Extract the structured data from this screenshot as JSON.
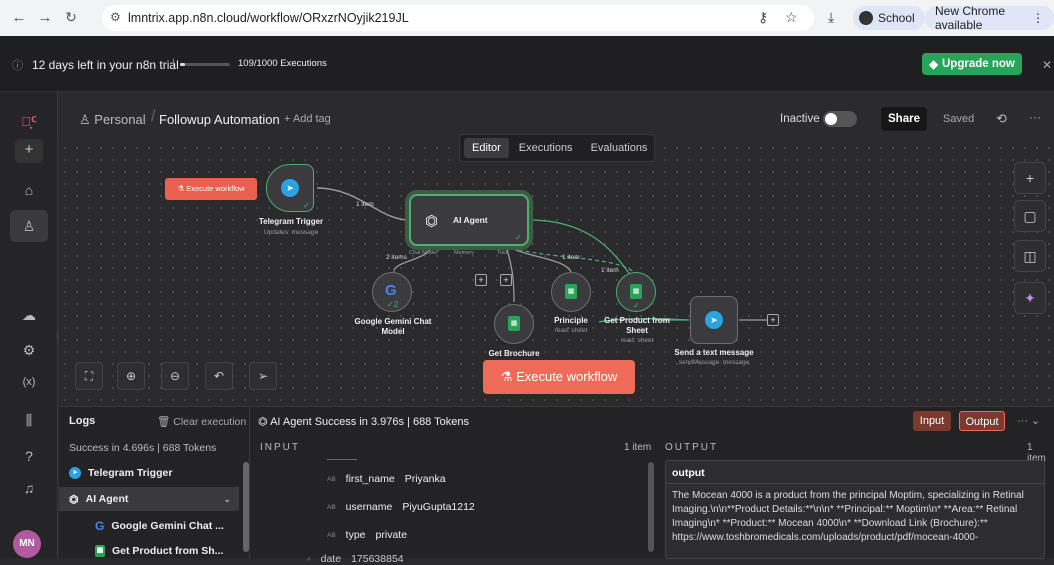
{
  "browser": {
    "url": "lmntrix.app.n8n.cloud/workflow/ORxzrNOyjik219JL",
    "profile_label": "School",
    "update_label": "New Chrome available"
  },
  "banner": {
    "trial_text": "12 days left in your n8n trial",
    "executions_text": "109/1000 Executions",
    "executions_fraction": 0.109,
    "upgrade_label": "Upgrade now"
  },
  "header": {
    "project": "Personal",
    "workflow_name": "Followup Automation",
    "add_tag": "+ Add tag",
    "active_label": "Inactive",
    "share_label": "Share",
    "saved_label": "Saved"
  },
  "tabs": [
    "Editor",
    "Executions",
    "Evaluations"
  ],
  "canvas": {
    "execute_small": "Execute workflow",
    "execute_big": "Execute workflow",
    "nodes": {
      "telegram_trigger": {
        "name": "Telegram Trigger",
        "sub": "Updates: message"
      },
      "ai_agent": {
        "name": "AI Agent"
      },
      "gemini": {
        "name": "Google Gemini Chat Model"
      },
      "get_brochure": {
        "name": "Get Brochure"
      },
      "principle": {
        "name": "Principle",
        "sub": "read: sheet"
      },
      "get_product": {
        "name": "Get Product from Sheet",
        "sub": "read: sheet"
      },
      "send_message": {
        "name": "Send a text message",
        "sub": "sendMessage: message"
      }
    },
    "ports": {
      "chat_model": "Chat Model*",
      "memory": "Memory",
      "tool": "Tool"
    },
    "edge_labels": {
      "trigger_agent": "1 item",
      "model": "2 items",
      "tool": "1 item",
      "product": "1 item"
    }
  },
  "logs": {
    "title": "Logs",
    "clear": "Clear execution",
    "summary": "Success in 4.696s | 688 Tokens",
    "items": [
      "Telegram Trigger",
      "AI Agent",
      "Google Gemini Chat ...",
      "Get Product from Sh..."
    ]
  },
  "run": {
    "header": "AI Agent  Success in 3.976s | 688 Tokens",
    "input_btn": "Input",
    "output_btn": "Output",
    "input_label": "INPUT",
    "input_count": "1 item",
    "output_label": "OUTPUT",
    "output_count": "1 item",
    "fields": [
      {
        "key": "first_name",
        "value": "Priyanka"
      },
      {
        "key": "username",
        "value": "PiyuGupta1212"
      },
      {
        "key": "type",
        "value": "private"
      },
      {
        "key": "date",
        "value": "175638854"
      }
    ],
    "output_key": "output",
    "output_text": "The Mocean 4000 is a product from the principal Moptim, specializing in Retinal Imaging.\\n\\n**Product Details:**\\n\\n* **Principal:** Moptim\\n* **Area:** Retinal Imaging\\n* **Product:** Mocean 4000\\n* **Download Link (Brochure):** https://www.toshbromedicals.com/uploads/product/pdf/mocean-4000-"
  }
}
